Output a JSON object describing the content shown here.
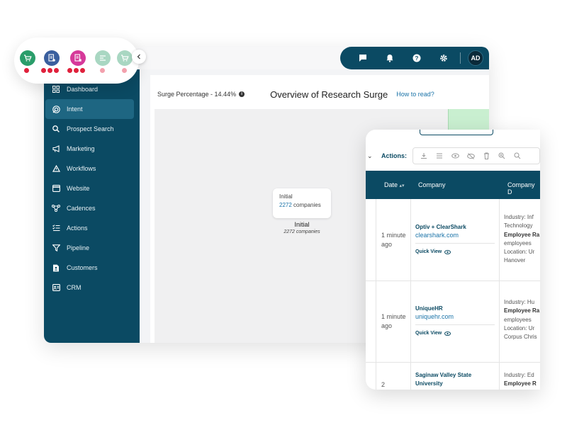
{
  "topbar": {
    "avatar_initials": "AD"
  },
  "sidebar": {
    "items": [
      {
        "label": "Dashboard",
        "icon": "grid-icon"
      },
      {
        "label": "Intent",
        "icon": "intent-icon",
        "active": true
      },
      {
        "label": "Prospect Search",
        "icon": "search-icon"
      },
      {
        "label": "Marketing",
        "icon": "megaphone-icon"
      },
      {
        "label": "Workflows",
        "icon": "workflow-icon"
      },
      {
        "label": "Website",
        "icon": "browser-icon"
      },
      {
        "label": "Cadences",
        "icon": "cadence-icon"
      },
      {
        "label": "Actions",
        "icon": "checklist-icon"
      },
      {
        "label": "Pipeline",
        "icon": "funnel-icon"
      },
      {
        "label": "Customers",
        "icon": "customers-icon"
      },
      {
        "label": "CRM",
        "icon": "crm-icon"
      }
    ]
  },
  "header": {
    "surge_label": "Surge Percentage - 14.44%",
    "title": "Overview of Research Surge",
    "how_to": "How to read?"
  },
  "node": {
    "card_title": "Initial",
    "card_count": "2272",
    "card_unit": " companies",
    "label": "Initial",
    "sublabel": "2272 companies"
  },
  "table": {
    "actions_label": "Actions:",
    "columns": [
      "Date",
      "Company",
      "Company D"
    ],
    "rows": [
      {
        "date": "1 minute ago",
        "name": "Optiv + ClearShark",
        "domain": "clearshark.com",
        "quick_view": "Quick View",
        "details": [
          "Industry: Inf",
          "Technology",
          "Employee Ra",
          "employees",
          "Location: Ur",
          "Hanover"
        ]
      },
      {
        "date": "1 minute ago",
        "name": "UniqueHR",
        "domain": "uniquehr.com",
        "quick_view": "Quick View",
        "details": [
          "Industry: Hu",
          "Employee Ra",
          "employees",
          "Location: Ur",
          "Corpus Chris"
        ]
      },
      {
        "date": "2",
        "name": "Saginaw Valley State University",
        "domain": "",
        "quick_view": "",
        "details": [
          "Industry: Ed",
          "Employee R"
        ]
      }
    ]
  },
  "colors": {
    "brand": "#0b4a63",
    "link": "#1a73a8",
    "signal_green": "#2a9d6a",
    "signal_blue": "#3a5f9e",
    "signal_pink": "#d6399a",
    "signal_faded": "#a9d7c2",
    "flame_red": "#e0213c",
    "flame_faded": "#f3a1ad"
  }
}
